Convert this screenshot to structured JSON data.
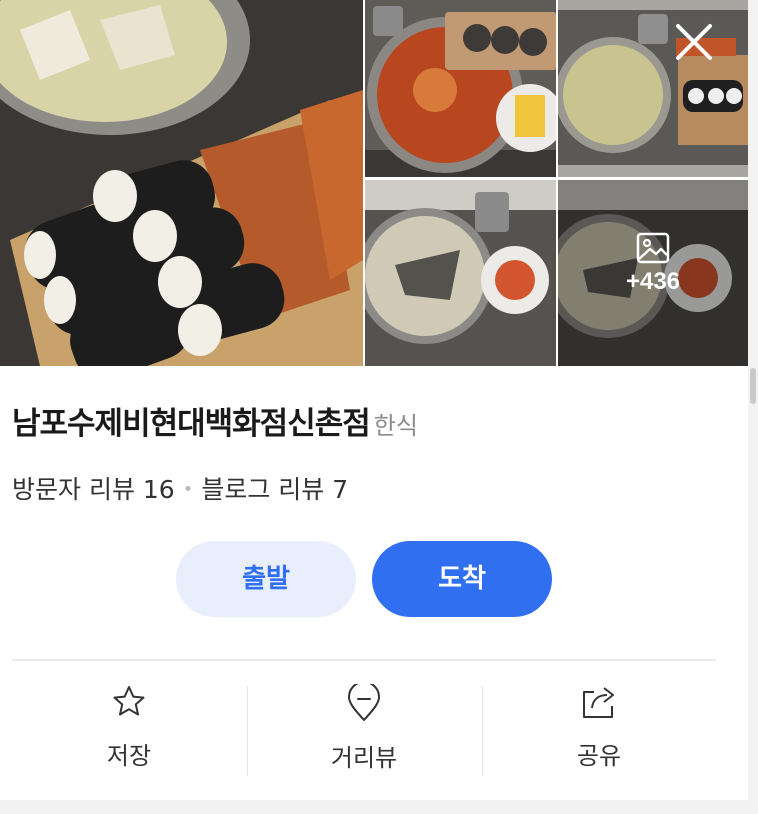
{
  "photos": {
    "more_count": "+436"
  },
  "place": {
    "name": "남포수제비현대백화점신촌점",
    "category": "한식",
    "visitor_reviews": "방문자 리뷰 16",
    "blog_reviews": "블로그 리뷰 7"
  },
  "buttons": {
    "depart": "출발",
    "arrive": "도착"
  },
  "actions": {
    "save": "저장",
    "street_view": "거리뷰",
    "share": "공유"
  },
  "colors": {
    "accent": "#2f6ff0",
    "accent_light": "#e8eefc"
  }
}
